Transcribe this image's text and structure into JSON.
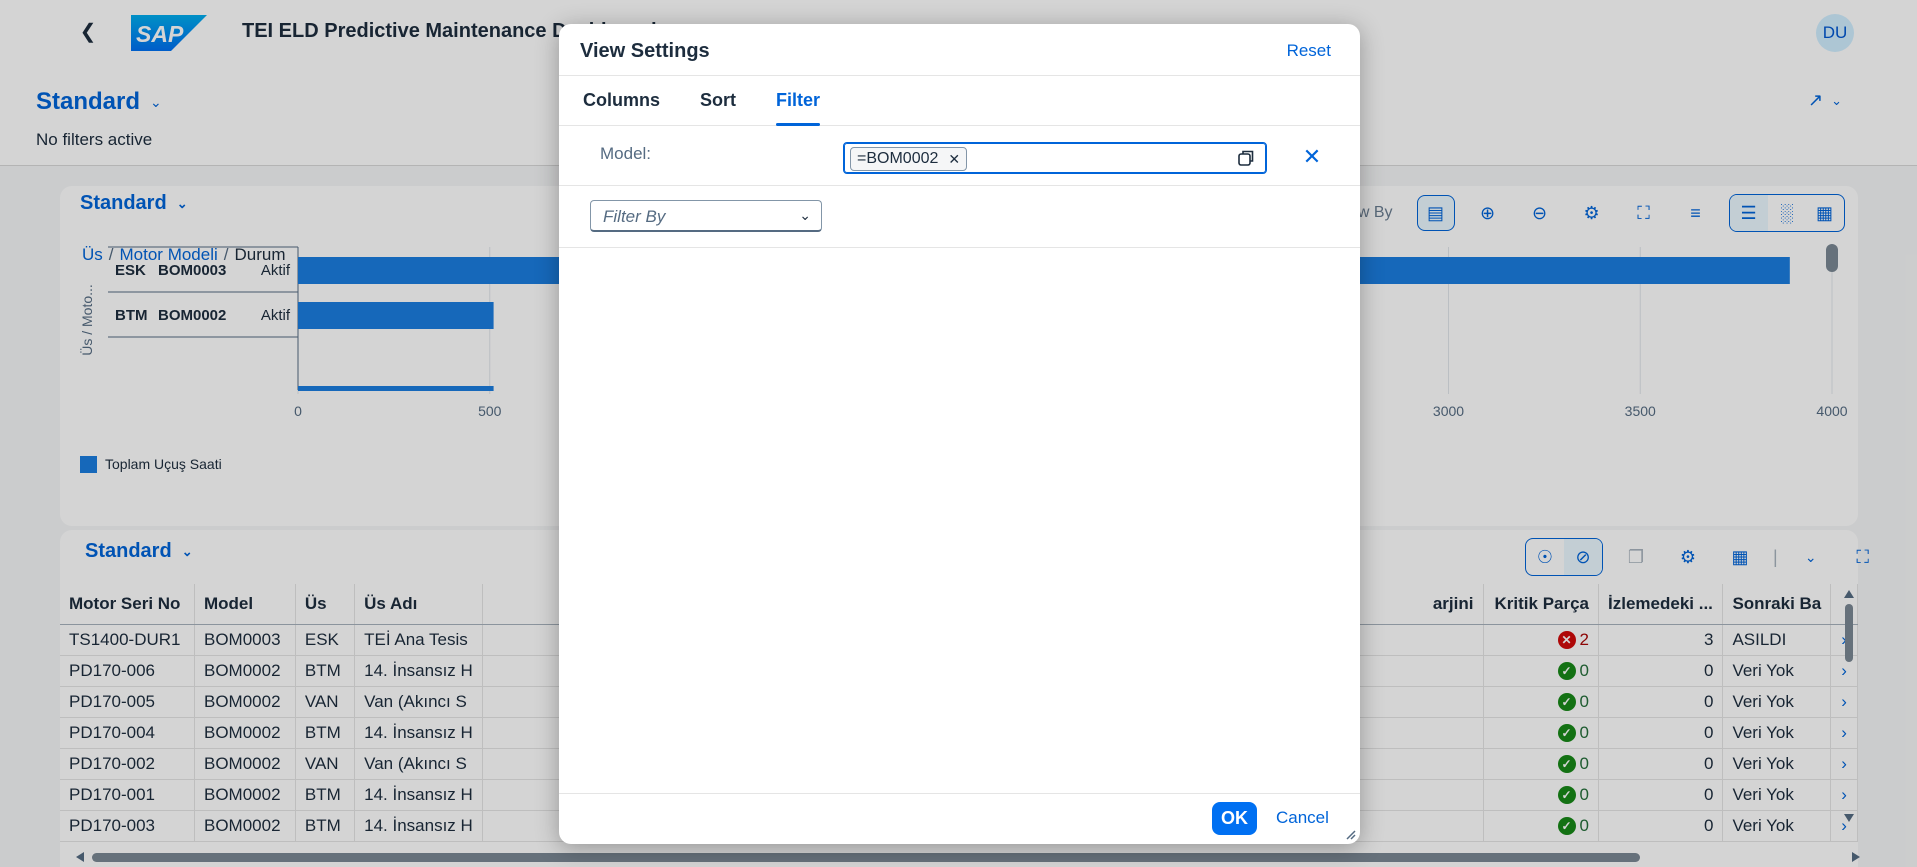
{
  "shell": {
    "title": "TEI ELD Predictive Maintenance Dashboard",
    "logo": "SAP",
    "avatar": "DU"
  },
  "header": {
    "variant": "Standard",
    "filters_text": "No filters active"
  },
  "chart_card": {
    "variant": "Standard",
    "breadcrumb": [
      "Üs",
      "Motor Modeli",
      "Durum"
    ],
    "view_by": "View By",
    "y_axis_label": "Üs / Moto...",
    "legend": "Toplam Uçuş Saati"
  },
  "chart_data": {
    "type": "bar",
    "orientation": "horizontal",
    "categories": [
      {
        "us": "ESK",
        "model": "BOM0003",
        "durum": "Aktif"
      },
      {
        "us": "BTM",
        "model": "BOM0002",
        "durum": "Aktif"
      }
    ],
    "series": [
      {
        "name": "Toplam Uçuş Saati",
        "values": [
          3890,
          510
        ]
      }
    ],
    "x_ticks": [
      "0",
      "500",
      "3000",
      "3500",
      "4000"
    ],
    "xlim": [
      0,
      4000
    ],
    "color": "#1b7ee0"
  },
  "table_card": {
    "variant": "Standard",
    "columns": [
      "Motor Seri No",
      "Model",
      "Üs",
      "Üs Adı",
      "arjini",
      "Kritik Parça",
      "İzlemedeki ...",
      "Sonraki Ba"
    ],
    "rows": [
      {
        "seri": "TS1400-DUR1",
        "model": "BOM0003",
        "us": "ESK",
        "usadi": "TEİ Ana Tesis",
        "kritik": "2",
        "kritik_status": "error",
        "izleme": "3",
        "sonraki": "ASILDI"
      },
      {
        "seri": "PD170-006",
        "model": "BOM0002",
        "us": "BTM",
        "usadi": "14. İnsansız H",
        "kritik": "0",
        "kritik_status": "ok",
        "izleme": "0",
        "sonraki": "Veri Yok"
      },
      {
        "seri": "PD170-005",
        "model": "BOM0002",
        "us": "VAN",
        "usadi": "Van (Akıncı S",
        "kritik": "0",
        "kritik_status": "ok",
        "izleme": "0",
        "sonraki": "Veri Yok"
      },
      {
        "seri": "PD170-004",
        "model": "BOM0002",
        "us": "BTM",
        "usadi": "14. İnsansız H",
        "kritik": "0",
        "kritik_status": "ok",
        "izleme": "0",
        "sonraki": "Veri Yok"
      },
      {
        "seri": "PD170-002",
        "model": "BOM0002",
        "us": "VAN",
        "usadi": "Van (Akıncı S",
        "kritik": "0",
        "kritik_status": "ok",
        "izleme": "0",
        "sonraki": "Veri Yok"
      },
      {
        "seri": "PD170-001",
        "model": "BOM0002",
        "us": "BTM",
        "usadi": "14. İnsansız H",
        "kritik": "0",
        "kritik_status": "ok",
        "izleme": "0",
        "sonraki": "Veri Yok"
      },
      {
        "seri": "PD170-003",
        "model": "BOM0002",
        "us": "BTM",
        "usadi": "14. İnsansız H",
        "kritik": "0",
        "kritik_status": "ok",
        "izleme": "0",
        "sonraki": "Veri Yok"
      }
    ]
  },
  "dialog": {
    "title": "View Settings",
    "reset": "Reset",
    "tabs": [
      "Columns",
      "Sort",
      "Filter"
    ],
    "active_tab": "Filter",
    "filter_label": "Model:",
    "token": "=BOM0002",
    "filter_by_placeholder": "Filter By",
    "ok": "OK",
    "cancel": "Cancel"
  }
}
